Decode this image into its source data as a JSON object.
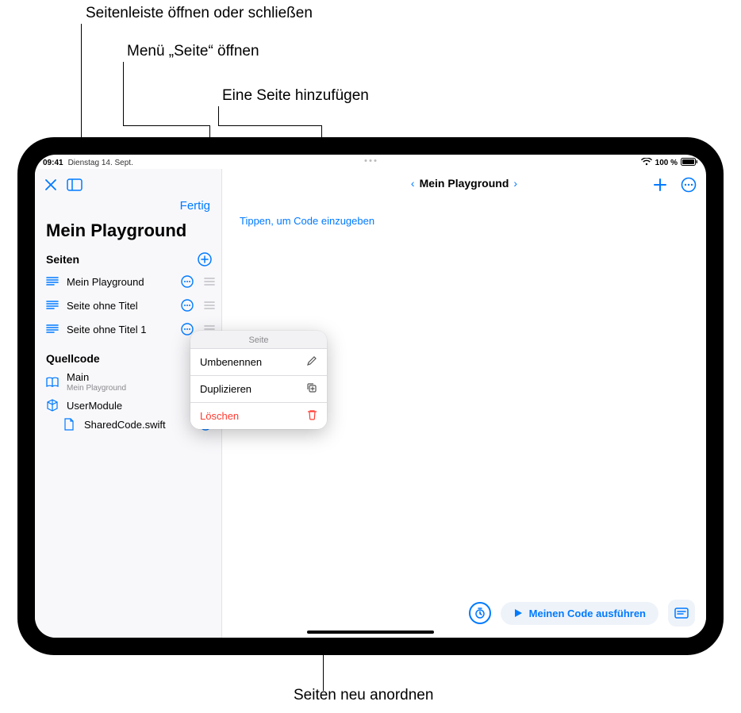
{
  "callouts": {
    "sidebar_toggle": "Seitenleiste öffnen oder schließen",
    "page_menu": "Menü „Seite“ öffnen",
    "add_page": "Eine Seite hinzufügen",
    "reorder_pages": "Seiten neu anordnen"
  },
  "statusbar": {
    "time": "09:41",
    "date": "Dienstag 14. Sept.",
    "battery": "100 %"
  },
  "toolbar": {
    "done_label": "Fertig"
  },
  "breadcrumb": {
    "title": "Mein Playground"
  },
  "sidebar": {
    "title": "Mein Playground",
    "sections": {
      "pages_header": "Seiten",
      "sources_header": "Quellcode"
    },
    "pages": [
      {
        "label": "Mein Playground"
      },
      {
        "label": "Seite ohne Titel"
      },
      {
        "label": "Seite ohne Titel 1"
      }
    ],
    "sources": {
      "main_label": "Main",
      "main_sub": "Mein Playground",
      "module_label": "UserModule",
      "file_label": "SharedCode.swift"
    }
  },
  "context_menu": {
    "title": "Seite",
    "rename": "Umbenennen",
    "duplicate": "Duplizieren",
    "delete": "Löschen"
  },
  "editor": {
    "placeholder": "Tippen, um Code einzugeben"
  },
  "bottombar": {
    "run_label": "Meinen Code ausführen"
  }
}
